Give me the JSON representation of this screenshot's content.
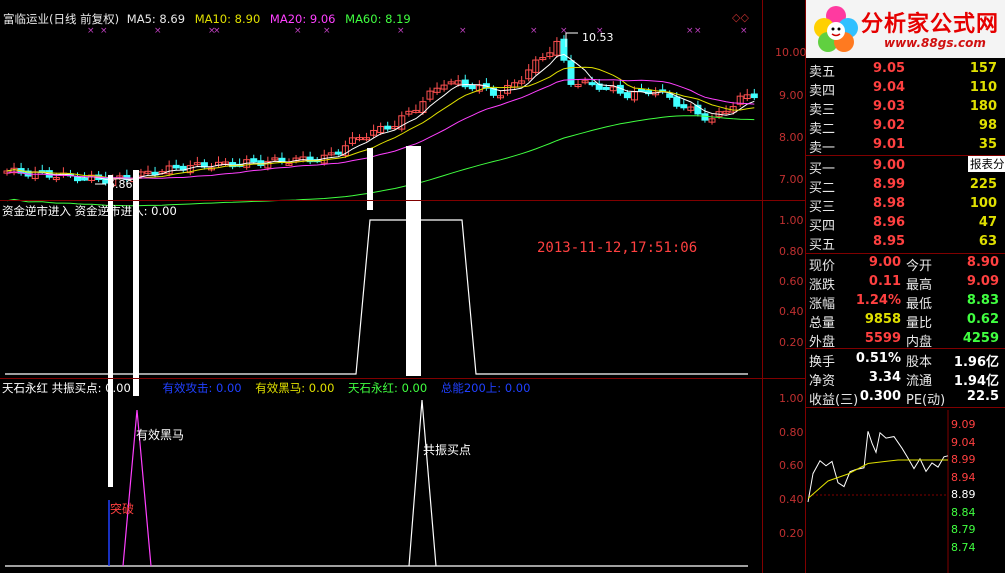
{
  "main_header": {
    "name": "富临运业(日线 前复权)",
    "ma5": "MA5: 8.69",
    "ma10": "MA10: 8.90",
    "ma20": "MA20: 9.06",
    "ma60": "MA60: 8.19",
    "high_marker": "10.53",
    "low_marker": "6.86"
  },
  "price_axis": [
    "10.00",
    "9.00",
    "8.00",
    "7.00"
  ],
  "panel2": {
    "header": "资金逆市进入  资金逆市进入: 0.00",
    "timestamp": "2013-11-12,17:51:06",
    "axis": [
      "1.00",
      "0.80",
      "0.60",
      "0.40",
      "0.20"
    ]
  },
  "panel3": {
    "header_main": "天石永红  共振买点: 0.00",
    "header_items": [
      {
        "label": "有效攻击: 0.00",
        "color": "#2040ff"
      },
      {
        "label": "有效黑马: 0.00",
        "color": "#e0e000"
      },
      {
        "label": "天石永红: 0.00",
        "color": "#40ff40"
      },
      {
        "label": "总能200上: 0.00",
        "color": "#2040ff"
      }
    ],
    "annotations": {
      "dark_horse": "有效黑马",
      "resonance": "共振买点",
      "breakout": "突破"
    },
    "axis": [
      "1.00",
      "0.80",
      "0.60",
      "0.40",
      "0.20"
    ]
  },
  "logo": {
    "title": "分析家公式网",
    "url": "www.88gs.com"
  },
  "order_book": {
    "asks": [
      {
        "label": "卖五",
        "price": "9.05",
        "volume": "157"
      },
      {
        "label": "卖四",
        "price": "9.04",
        "volume": "110"
      },
      {
        "label": "卖三",
        "price": "9.03",
        "volume": "180"
      },
      {
        "label": "卖二",
        "price": "9.02",
        "volume": "98"
      },
      {
        "label": "卖一",
        "price": "9.01",
        "volume": "35"
      }
    ],
    "bids": [
      {
        "label": "买一",
        "price": "9.00",
        "volume": ""
      },
      {
        "label": "买二",
        "price": "8.99",
        "volume": "225"
      },
      {
        "label": "买三",
        "price": "8.98",
        "volume": "100"
      },
      {
        "label": "买四",
        "price": "8.96",
        "volume": "47"
      },
      {
        "label": "买五",
        "price": "8.95",
        "volume": "63"
      }
    ],
    "report_button": "报表分"
  },
  "stats": [
    {
      "l1": "现价",
      "v1": "9.00",
      "c1": "#ff4040",
      "l2": "今开",
      "v2": "8.90",
      "c2": "#ff4040"
    },
    {
      "l1": "涨跌",
      "v1": "0.11",
      "c1": "#ff4040",
      "l2": "最高",
      "v2": "9.09",
      "c2": "#ff4040"
    },
    {
      "l1": "涨幅",
      "v1": "1.24%",
      "c1": "#ff4040",
      "l2": "最低",
      "v2": "8.83",
      "c2": "#40ff40"
    },
    {
      "l1": "总量",
      "v1": "9858",
      "c1": "#e0e000",
      "l2": "量比",
      "v2": "0.62",
      "c2": "#40ff40"
    },
    {
      "l1": "外盘",
      "v1": "5599",
      "c1": "#ff4040",
      "l2": "内盘",
      "v2": "4259",
      "c2": "#40ff40"
    },
    {
      "l1": "换手",
      "v1": "0.51%",
      "c1": "#ffffff",
      "l2": "股本",
      "v2": "1.96亿",
      "c2": "#ffffff"
    },
    {
      "l1": "净资",
      "v1": "3.34",
      "c1": "#ffffff",
      "l2": "流通",
      "v2": "1.94亿",
      "c2": "#ffffff"
    },
    {
      "l1": "收益(三)",
      "v1": "0.300",
      "c1": "#ffffff",
      "l2": "PE(动)",
      "v2": "22.5",
      "c2": "#ffffff"
    }
  ],
  "intraday_axis": [
    {
      "v": "9.09",
      "c": "#ff4040"
    },
    {
      "v": "9.04",
      "c": "#ff4040"
    },
    {
      "v": "8.99",
      "c": "#ff4040"
    },
    {
      "v": "8.94",
      "c": "#ff4040"
    },
    {
      "v": "8.89",
      "c": "#ffffff"
    },
    {
      "v": "8.84",
      "c": "#40ff40"
    },
    {
      "v": "8.79",
      "c": "#40ff40"
    },
    {
      "v": "8.74",
      "c": "#40ff40"
    }
  ],
  "colors": {
    "up": "#ff5050",
    "down": "#40ffff",
    "ma5": "#ffffff",
    "ma10": "#e0e000",
    "ma20": "#ff40ff",
    "ma60": "#40ff40",
    "border": "#800000"
  }
}
